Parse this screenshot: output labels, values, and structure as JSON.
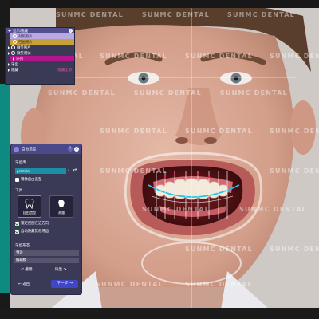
{
  "watermark": "SUNMC DENTAL",
  "layers_panel": {
    "header": "显示/隐藏",
    "items": [
      {
        "label": "对照照片",
        "style": "lilac"
      },
      {
        "label": "已画照片",
        "style": "gold"
      },
      {
        "label": "微笑照片",
        "style": "dark"
      },
      {
        "label": "微笑测试",
        "style": "dark"
      },
      {
        "label": "牙列",
        "style": "magenta"
      },
      {
        "label": "牙齿",
        "style": "dark"
      },
      {
        "label": "隐藏",
        "style": "dark",
        "link": "隐藏全部"
      }
    ]
  },
  "design_panel": {
    "title": "自由造型",
    "tooth_library_label": "牙齿库",
    "tooth_library_value": "premila",
    "mirror_label": "镜像自由造型",
    "tools_label": "工具",
    "tools": [
      {
        "label": "自由造型",
        "icon": "tooth-icon"
      },
      {
        "label": "测量",
        "icon": "measure-icon"
      }
    ],
    "options": [
      {
        "label": "锁定视图在这方向",
        "checked": true
      },
      {
        "label": "自动隐藏其他牙齿",
        "checked": true
      }
    ],
    "section_label": "牙齿形态",
    "preset_label": "预设",
    "edit_label": "编辑模",
    "back_label": "返回",
    "restore_label": "恢复",
    "next_label": "下一步",
    "undo_label": "撤销"
  },
  "colors": {
    "panel_bg": "#3a3956",
    "title_bar": "#4a4a8a",
    "accent_blue": "#3f47c8",
    "teal": "#1a8fa6"
  }
}
